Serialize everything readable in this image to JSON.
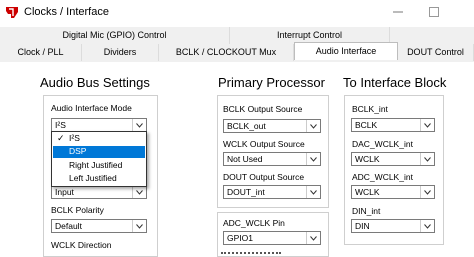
{
  "window": {
    "title": "Clocks / Interface"
  },
  "tabs_row1": [
    {
      "label": "Digital Mic (GPIO) Control"
    },
    {
      "label": "Interrupt Control"
    }
  ],
  "tabs_row2": [
    {
      "label": "Clock / PLL"
    },
    {
      "label": "Dividers"
    },
    {
      "label": "BCLK / CLOCKOUT  Mux"
    },
    {
      "label": "Audio Interface",
      "active": true
    },
    {
      "label": "DOUT Control"
    }
  ],
  "audio_bus": {
    "heading": "Audio Bus Settings",
    "mode_label": "Audio Interface Mode",
    "mode_value": "I²S",
    "hidden_value": "Input",
    "bclk_polarity_label": "BCLK Polarity",
    "bclk_polarity_value": "Default",
    "wclk_direction_label": "WCLK Direction"
  },
  "dropdown": {
    "options": [
      {
        "label": "I²S",
        "checked": true
      },
      {
        "label": "DSP",
        "highlighted": true
      },
      {
        "label": "Right Justified"
      },
      {
        "label": "Left Justified"
      }
    ]
  },
  "primary": {
    "heading": "Primary Processor",
    "bclk_out_label": "BCLK Output Source",
    "bclk_out_value": "BCLK_out",
    "wclk_out_label": "WCLK Output Source",
    "wclk_out_value": "Not Used",
    "dout_out_label": "DOUT Output Source",
    "dout_out_value": "DOUT_int",
    "adc_wclk_label": "ADC_WCLK Pin",
    "adc_wclk_value": "GPIO1"
  },
  "interface_block": {
    "heading": "To Interface Block",
    "bclk_int_label": "BCLK_int",
    "bclk_int_value": "BCLK",
    "dac_wclk_label": "DAC_WCLK_int",
    "dac_wclk_value": "WCLK",
    "adc_wclk_label": "ADC_WCLK_int",
    "adc_wclk_value": "WCLK",
    "din_label": "DIN_int",
    "din_value": "DIN"
  },
  "colors": {
    "highlight": "#0078d7",
    "logo": "#cc0000",
    "panel": "#f0f0f0"
  }
}
